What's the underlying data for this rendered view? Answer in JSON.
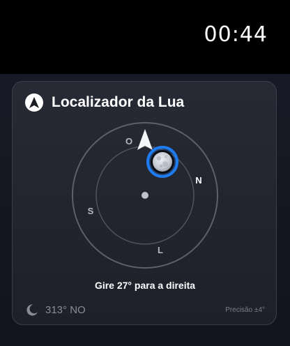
{
  "status_bar": {
    "time": "00:44"
  },
  "widget": {
    "title": "Localizador da Lua",
    "title_icon": "navigation-arrow-icon",
    "compass": {
      "north": "N",
      "south": "S",
      "east": "L",
      "west": "O",
      "moon_icon": "full-moon-icon",
      "pointer_icon": "direction-pointer-icon"
    },
    "instruction": "Gire 27° para a direita",
    "heading_icon": "crescent-moon-icon",
    "heading": "313° NO",
    "precision": "Precisão ±4°"
  },
  "colors": {
    "accent": "#1f7bf2",
    "background": "#151822",
    "card": "#24272f",
    "text": "#ffffff",
    "muted": "#8a8d97"
  }
}
